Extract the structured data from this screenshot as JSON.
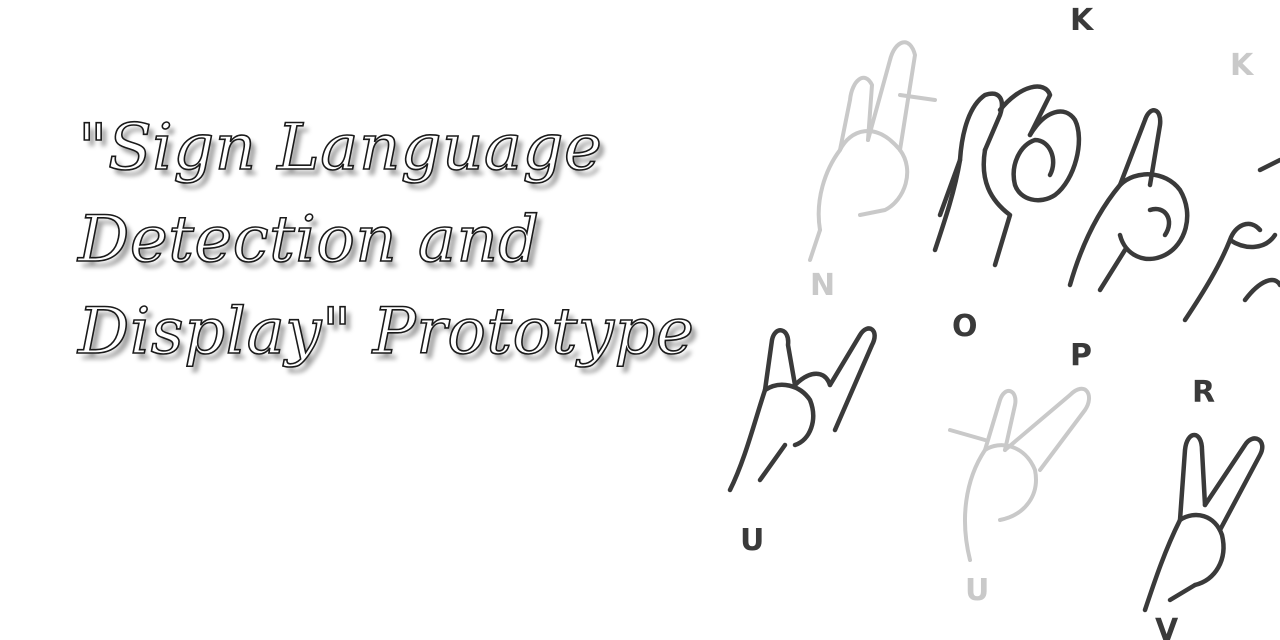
{
  "title": {
    "line1": "\"Sign Language",
    "line2": "Detection and",
    "line3": "Display\" Prototype"
  },
  "illustration": {
    "letters": [
      "K",
      "K",
      "N",
      "O",
      "P",
      "R",
      "U",
      "V",
      "U"
    ]
  }
}
